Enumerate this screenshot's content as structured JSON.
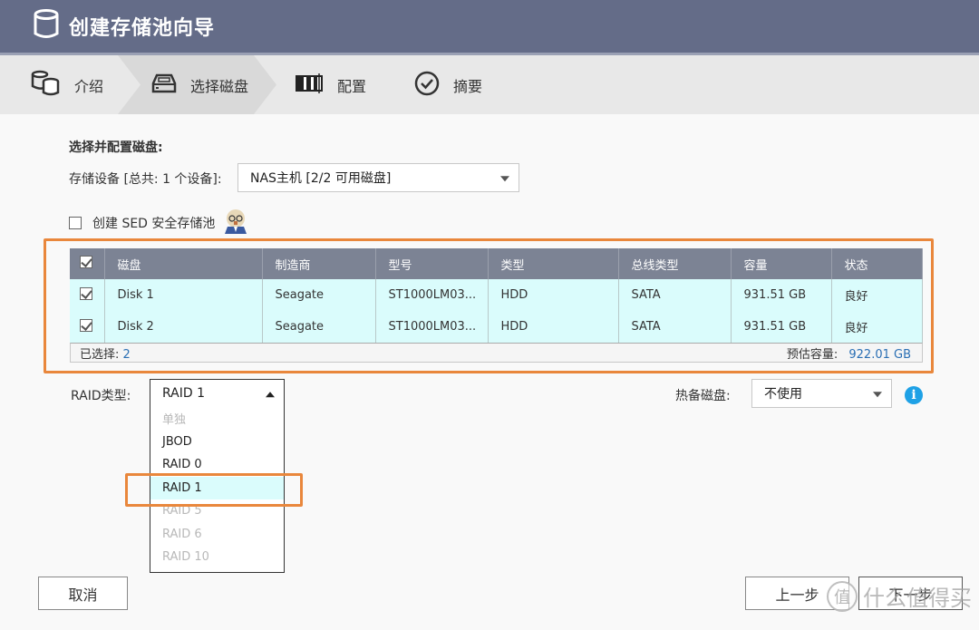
{
  "window": {
    "title": "创建存储池向导",
    "icon": "database-icon"
  },
  "steps": [
    {
      "label": "介绍",
      "icon": "databases-icon",
      "active": false
    },
    {
      "label": "选择磁盘",
      "icon": "disk-drive-icon",
      "active": true
    },
    {
      "label": "配置",
      "icon": "raid-config-icon",
      "active": false
    },
    {
      "label": "摘要",
      "icon": "check-circle-icon",
      "active": false
    }
  ],
  "form": {
    "section_title": "选择并配置磁盘:",
    "device_label": "存储设备 [总共: 1 个设备]:",
    "device_value": "NAS主机 [2/2 可用磁盘]",
    "sed_checkbox_label": "创建 SED 安全存储池",
    "sed_checked": false,
    "sed_icon": "professor-avatar-icon"
  },
  "table": {
    "columns": [
      "磁盘",
      "制造商",
      "型号",
      "类型",
      "总线类型",
      "容量",
      "状态"
    ],
    "header_checked": true,
    "rows": [
      {
        "checked": true,
        "disk": "Disk 1",
        "vendor": "Seagate",
        "model": "ST1000LM03...",
        "type": "HDD",
        "bus": "SATA",
        "capacity": "931.51 GB",
        "status": "良好"
      },
      {
        "checked": true,
        "disk": "Disk 2",
        "vendor": "Seagate",
        "model": "ST1000LM03...",
        "type": "HDD",
        "bus": "SATA",
        "capacity": "931.51 GB",
        "status": "良好"
      }
    ],
    "selected_label": "已选择:",
    "selected_count": "2",
    "estimated_label": "预估容量:",
    "estimated_value": "922.01 GB"
  },
  "raid": {
    "label": "RAID类型:",
    "value": "RAID 1",
    "options": [
      {
        "label": "单独",
        "disabled": true
      },
      {
        "label": "JBOD",
        "disabled": false
      },
      {
        "label": "RAID 0",
        "disabled": false
      },
      {
        "label": "RAID 1",
        "disabled": false,
        "selected": true
      },
      {
        "label": "RAID 5",
        "disabled": true
      },
      {
        "label": "RAID 6",
        "disabled": true
      },
      {
        "label": "RAID 10",
        "disabled": true
      }
    ]
  },
  "hot_spare": {
    "label": "热备磁盘:",
    "value": "不使用"
  },
  "buttons": {
    "cancel": "取消",
    "back": "上一步",
    "next": "下一步"
  },
  "watermark": {
    "glyph": "值",
    "text": "什么值得买"
  },
  "colors": {
    "titlebar": "#646c88",
    "highlight": "#e9873c",
    "row_bg": "#dafcfc",
    "header_bg": "#7c8394",
    "link_blue": "#2a6fb4",
    "info_blue": "#1ea1e6"
  }
}
